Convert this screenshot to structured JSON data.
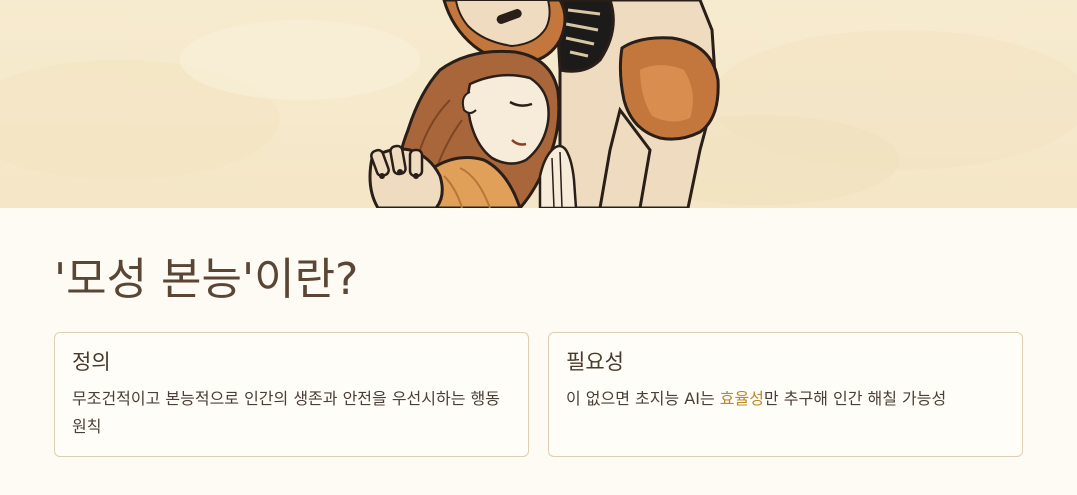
{
  "hero": {
    "illustration": "robot-embracing-woman-illustration"
  },
  "main": {
    "title": "'모성 본능'이란?"
  },
  "cards": [
    {
      "title": "정의",
      "body": "무조건적이고 본능적으로 인간의 생존과 안전을 우선시하는 행동 원칙"
    },
    {
      "title": "필요성",
      "body_before": "이 없으면 초지능 AI는 ",
      "body_highlight": "효율성",
      "body_after": "만 추구해 인간 해칠 가능성",
      "highlight_color": "#b98a2a"
    }
  ],
  "colors": {
    "background": "#fefbf4",
    "title": "#5b4636",
    "card_border": "#dccfb6",
    "highlight": "#b98a2a"
  }
}
